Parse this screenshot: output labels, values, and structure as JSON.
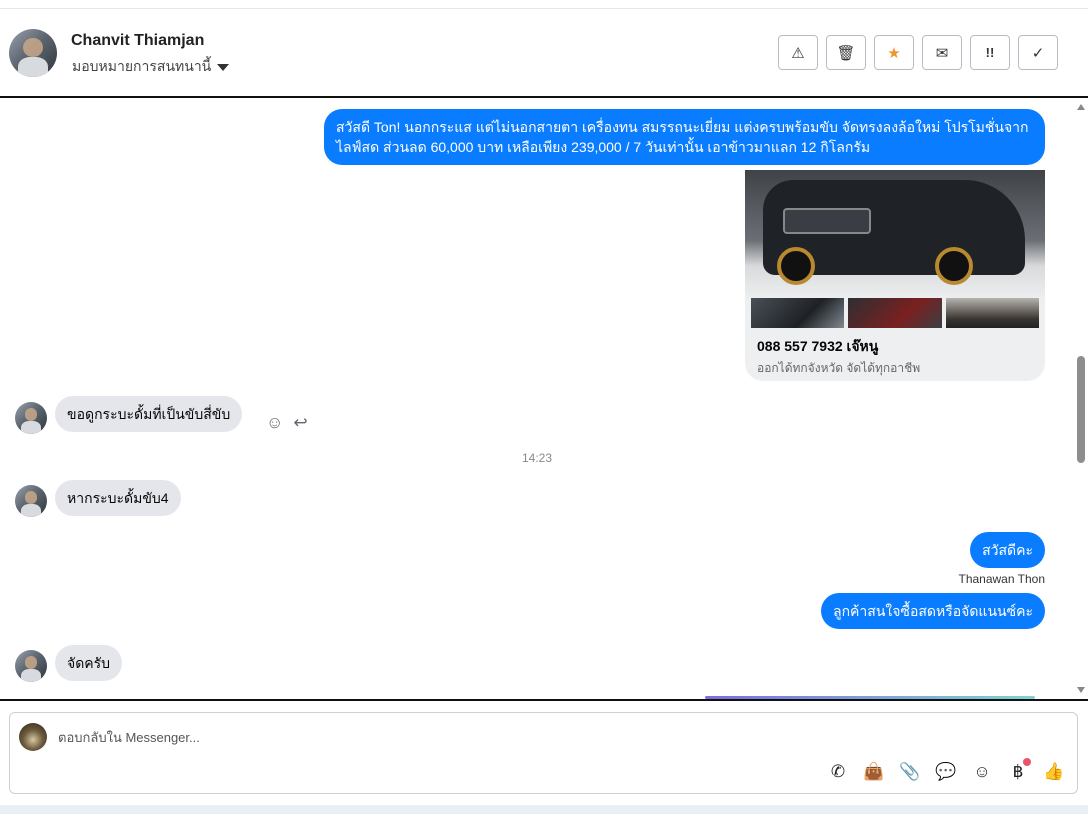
{
  "header": {
    "contact_name": "Chanvit Thiamjan",
    "assign_label": "มอบหมายการสนทนานี้",
    "tools": [
      {
        "icon": "warning-icon",
        "glyph": "⚠"
      },
      {
        "icon": "trash-icon",
        "glyph": "🗑"
      },
      {
        "icon": "star-icon",
        "glyph": "★"
      },
      {
        "icon": "envelope-open-icon",
        "glyph": "✉"
      },
      {
        "icon": "follow-up-icon",
        "glyph": "!!"
      },
      {
        "icon": "check-icon",
        "glyph": "✓"
      }
    ]
  },
  "conversation": {
    "messages": [
      {
        "direction": "out",
        "text": "สวัสดี Ton! นอกกระแส แต่ไม่นอกสายตา เครื่องทน สมรรถนะเยี่ยม แต่งครบพร้อมขับ จัดทรงลงล้อใหม่ โปรโมชั่นจากไลฟ์สด ส่วนลด 60,000 บาท เหลือเพียง 239,000 / 7 วันเท่านั้น เอาข้าวมาแลก 12 กิโลกรัม"
      },
      {
        "direction": "in",
        "text": "ขอดูกระบะดั้มที่เป็นขับสี่ขับ"
      },
      {
        "direction": "in",
        "text": "หากระบะดั้มขับ4"
      },
      {
        "direction": "out",
        "text": "สวัสดีคะ"
      },
      {
        "direction": "out",
        "text": "ลูกค้าสนใจซื้อสดหรือจัดแนนซ์คะ"
      },
      {
        "direction": "in",
        "text": "จัดครับ"
      }
    ],
    "card": {
      "title": "088 557 7932 เจ๊หนู",
      "subtitle": "ออกได้ทกจังหวัด จัดได้ทุกอาชีพ"
    },
    "timestamp": "14:23",
    "sender_label": "Thanawan Thon"
  },
  "composer": {
    "placeholder": "ตอบกลับใน Messenger...",
    "icons": [
      "phone-plus-icon",
      "shopping-bag-icon",
      "paperclip-icon",
      "chat-bubble-icon",
      "emoji-icon",
      "baht-icon",
      "thumbs-up-icon"
    ]
  },
  "colors": {
    "outgoing_bubble": "#0a7cff",
    "incoming_bubble": "#e4e6eb",
    "star_accent": "#f0922e",
    "notification_dot": "#e9566a"
  }
}
